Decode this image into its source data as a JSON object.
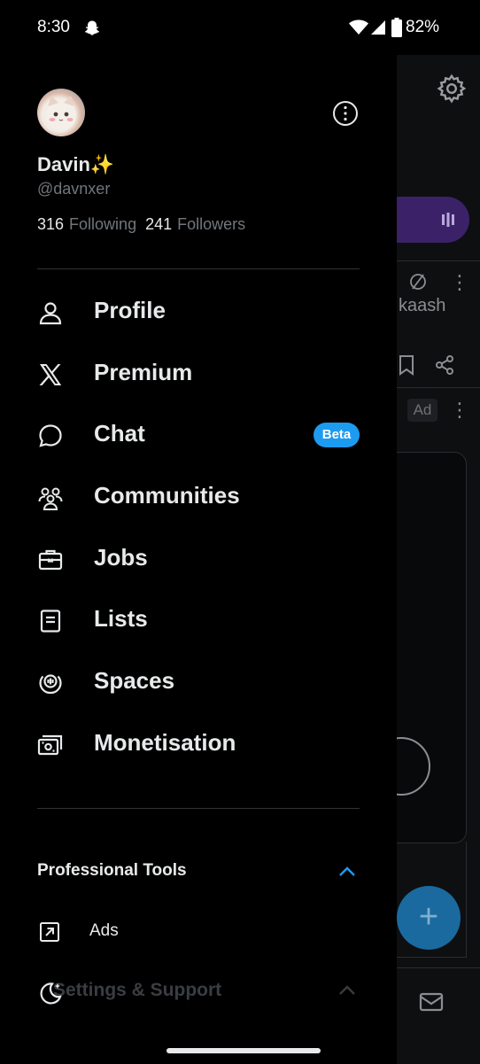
{
  "status_bar": {
    "time": "8:30",
    "battery": "82%"
  },
  "profile": {
    "name": "Davin✨",
    "handle": "@davnxer",
    "following_count": "316",
    "following_label": "Following",
    "followers_count": "241",
    "followers_label": "Followers"
  },
  "menu": {
    "items": [
      {
        "label": "Profile",
        "icon": "person-icon"
      },
      {
        "label": "Premium",
        "icon": "x-logo-icon"
      },
      {
        "label": "Chat",
        "icon": "chat-bubble-icon",
        "badge": "Beta"
      },
      {
        "label": "Communities",
        "icon": "people-icon"
      },
      {
        "label": "Jobs",
        "icon": "briefcase-icon"
      },
      {
        "label": "Lists",
        "icon": "list-icon"
      },
      {
        "label": "Spaces",
        "icon": "spaces-icon"
      },
      {
        "label": "Monetisation",
        "icon": "money-icon"
      }
    ]
  },
  "professional_tools": {
    "title": "Professional Tools",
    "ads_label": "Ads"
  },
  "settings_support": {
    "title": "Settings & Support"
  },
  "background": {
    "user_fragment": "kaash",
    "ad_badge": "Ad",
    "compose_symbol": "+"
  },
  "colors": {
    "accent": "#1d9bf0",
    "background": "#000000",
    "text": "#e7e9ea",
    "muted": "#71767b"
  }
}
